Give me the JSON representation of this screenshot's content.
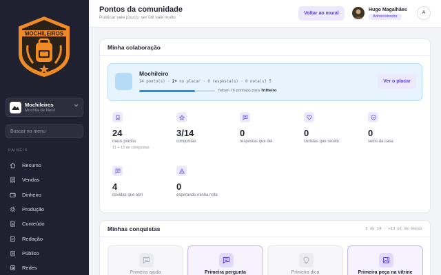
{
  "sidebar": {
    "logo_text": "MOCHILEIROS",
    "store": {
      "name": "Mochileiros",
      "subtitle": "Mochila de Nerd"
    },
    "search_placeholder": "Buscar no menu",
    "section_label": "PAINÉIS",
    "items": [
      {
        "label": "Resumo",
        "icon": "home-icon"
      },
      {
        "label": "Vendas",
        "icon": "receipt-icon"
      },
      {
        "label": "Dinheiro",
        "icon": "wallet-icon"
      },
      {
        "label": "Produção",
        "icon": "gear-icon"
      },
      {
        "label": "Conteúdo",
        "icon": "document-icon"
      },
      {
        "label": "Redação",
        "icon": "pen-icon"
      },
      {
        "label": "Público",
        "icon": "clipboard-icon"
      },
      {
        "label": "Redes",
        "icon": "instagram-icon"
      }
    ]
  },
  "header": {
    "title": "Pontos da comunidade",
    "subtitle": "Publicar vale pouco; ser útil vale muito",
    "back_button": "Voltar ao mural",
    "user_name": "Hugo Magalhães",
    "user_role": "Administrador",
    "user_initial": "A"
  },
  "collab": {
    "title": "Minha colaboração",
    "tier": {
      "name": "Mochileiro",
      "stats_points": "24 ponto(s) · ",
      "stats_rank": "2º",
      "stats_rest": " no placar · 0 resposta(s) · 0 nota(s) 5",
      "progress": 0.74,
      "remaining_prefix": "faltam 76 ponto(s) para ",
      "remaining_target": "Trilheiro",
      "button": "Ver o placar"
    },
    "stats": [
      {
        "value": "24",
        "label": "meus pontos",
        "note": "11 + 13 de conquistas",
        "icon": "bookmark-icon"
      },
      {
        "value": "3/14",
        "label": "conquistas",
        "note": "",
        "icon": "star-icon"
      },
      {
        "value": "0",
        "label": "respostas que dei",
        "note": "",
        "icon": "message-icon"
      },
      {
        "value": "0",
        "label": "curtidas que recebi",
        "note": "",
        "icon": "heart-icon"
      },
      {
        "value": "0",
        "label": "selos da casa",
        "note": "",
        "icon": "shield-check-icon"
      },
      {
        "value": "4",
        "label": "dúvidas que abri",
        "note": "",
        "icon": "chat-icon"
      },
      {
        "value": "0",
        "label": "esperando minha nota",
        "note": "",
        "icon": "warning-icon"
      }
    ]
  },
  "achievements": {
    "title": "Minhas conquistas",
    "count": "3 de 14 · +13 pt de bônus",
    "items": [
      {
        "name": "Primeira ajuda",
        "unlocked": false,
        "icon": "message-icon"
      },
      {
        "name": "Primeira pergunta",
        "unlocked": true,
        "icon": "chat-icon"
      },
      {
        "name": "Primeira dica",
        "unlocked": false,
        "icon": "lightbulb-icon"
      },
      {
        "name": "Primeira peça na vitrine",
        "unlocked": true,
        "icon": "image-icon"
      }
    ]
  },
  "colors": {
    "sidebar_bg": "#1f2130",
    "accent": "#5b3fd6",
    "accent_soft": "#ece8fd",
    "logo_orange": "#f08a24",
    "tier_bg": "#e7f3fd"
  }
}
